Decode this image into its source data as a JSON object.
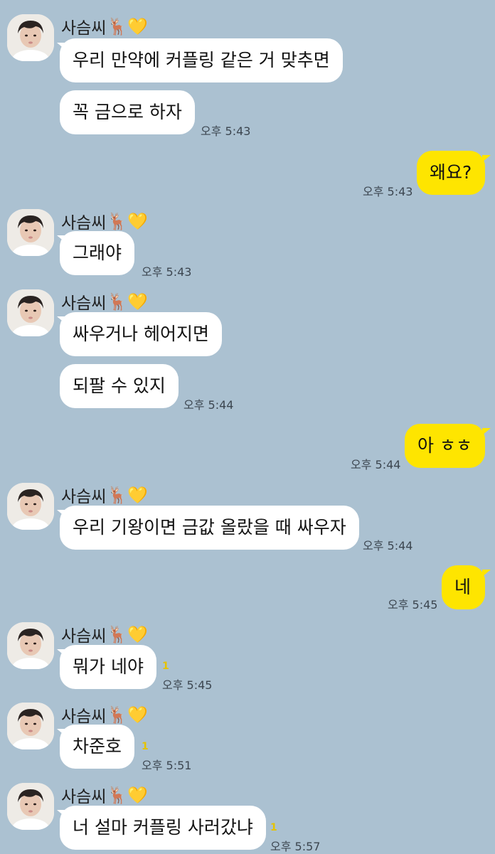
{
  "sender_name": "사슴씨",
  "sender_emoji": "🦌💛",
  "messages": {
    "m1": "우리 만약에 커플링 같은 거 맞추면",
    "m2": "꼭 금으로 하자",
    "m3": "왜요?",
    "m4": "그래야",
    "m5": "싸우거나 헤어지면",
    "m6": "되팔 수 있지",
    "m7": "아 ㅎㅎ",
    "m8": "우리 기왕이면 금값 올랐을 때 싸우자",
    "m9": "네",
    "m10": "뭐가 네야",
    "m11": "차준호",
    "m12": "너 설마 커플링 사러갔냐"
  },
  "times": {
    "t543": "오후 5:43",
    "t544": "오후 5:44",
    "t545": "오후 5:45",
    "t551": "오후 5:51",
    "t557": "오후 5:57"
  },
  "unread_count": "1",
  "colors": {
    "background": "#abc1d1",
    "my_bubble": "#fee500",
    "their_bubble": "#ffffff",
    "unread": "#e6c300"
  }
}
